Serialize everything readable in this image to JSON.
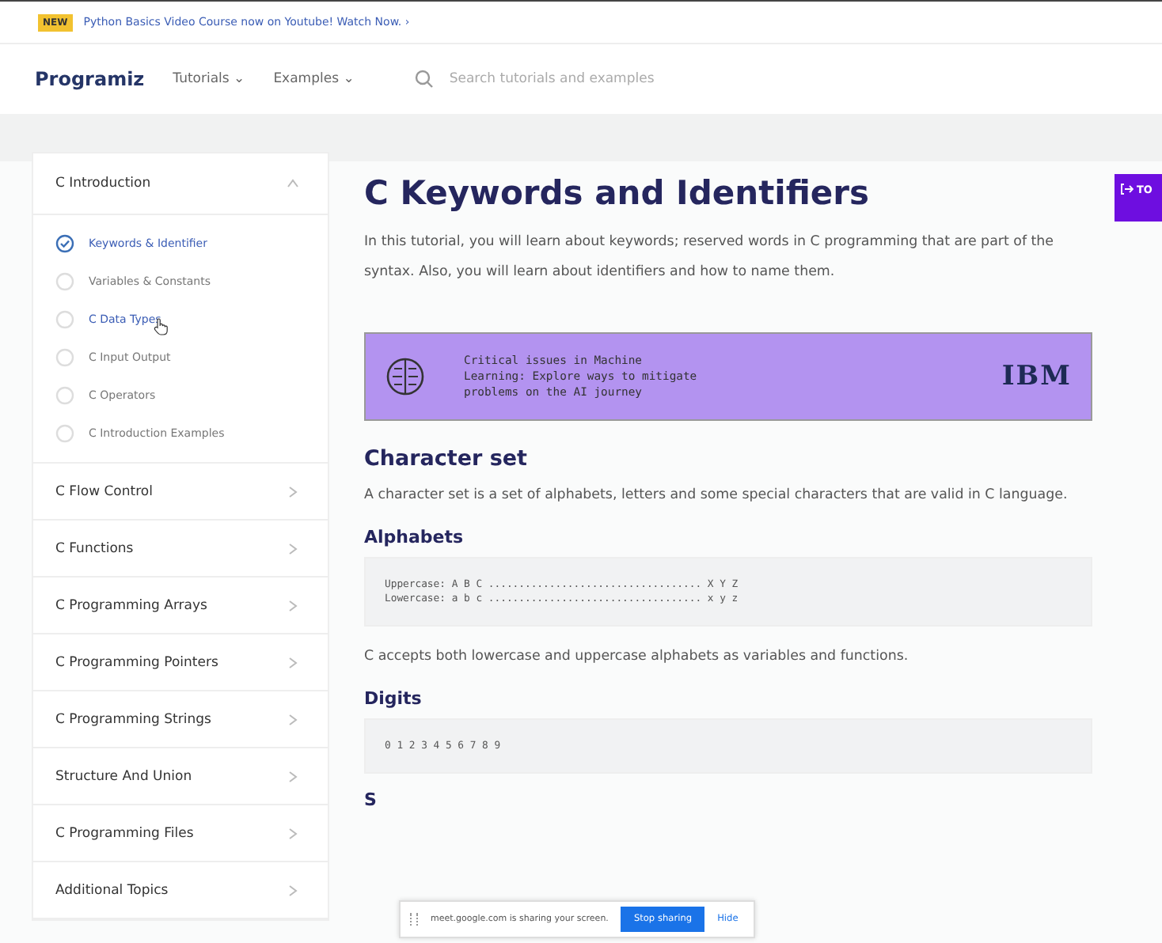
{
  "banner": {
    "badge": "NEW",
    "text": "Python Basics Video Course now on Youtube! Watch Now. ›"
  },
  "nav": {
    "logo": "Programiz",
    "menus": [
      {
        "label": "Tutorials ⌄"
      },
      {
        "label": "Examples ⌄"
      }
    ],
    "search": {
      "placeholder": "Search tutorials and examples"
    }
  },
  "sidebar": {
    "sections": [
      {
        "title": "C Introduction",
        "expanded": true,
        "items": [
          {
            "label": "Keywords & Identifier",
            "current": true,
            "hover": false
          },
          {
            "label": "Variables & Constants",
            "current": false,
            "hover": false
          },
          {
            "label": "C Data Types",
            "current": false,
            "hover": true
          },
          {
            "label": "C Input Output",
            "current": false,
            "hover": false
          },
          {
            "label": "C Operators",
            "current": false,
            "hover": false
          },
          {
            "label": "C Introduction Examples",
            "current": false,
            "hover": false
          }
        ]
      },
      {
        "title": "C Flow Control",
        "expanded": false
      },
      {
        "title": "C Functions",
        "expanded": false
      },
      {
        "title": "C Programming Arrays",
        "expanded": false
      },
      {
        "title": "C Programming Pointers",
        "expanded": false
      },
      {
        "title": "C Programming Strings",
        "expanded": false
      },
      {
        "title": "Structure And Union",
        "expanded": false
      },
      {
        "title": "C Programming Files",
        "expanded": false
      },
      {
        "title": "Additional Topics",
        "expanded": false
      }
    ]
  },
  "article": {
    "title": "C Keywords and Identifiers",
    "intro": "In this tutorial, you will learn about keywords; reserved words in C programming that are part of the syntax. Also, you will learn about identifiers and how to name them.",
    "ad": {
      "text": "Critical issues in Machine\nLearning: Explore ways to mitigate\nproblems on the AI journey",
      "brand": "IBM"
    },
    "blocks": [
      {
        "kind": "h2",
        "text": "Character set"
      },
      {
        "kind": "p",
        "text": "A character set is a set of alphabets, letters and some special characters that are valid in C language."
      },
      {
        "kind": "h3",
        "text": "Alphabets"
      },
      {
        "kind": "code",
        "text": "Uppercase: A B C ................................... X Y Z\nLowercase: a b c ................................... x y z"
      },
      {
        "kind": "p",
        "text": "C accepts both lowercase and uppercase alphabets as variables and functions."
      },
      {
        "kind": "h3",
        "text": "Digits"
      },
      {
        "kind": "code",
        "text": "0 1 2 3 4 5 6 7 8 9"
      },
      {
        "kind": "h3",
        "text": "S"
      }
    ]
  },
  "toc_button": {
    "label": "TO"
  },
  "share_bar": {
    "text": "meet.google.com is sharing your screen.",
    "stop": "Stop sharing",
    "hide": "Hide"
  }
}
